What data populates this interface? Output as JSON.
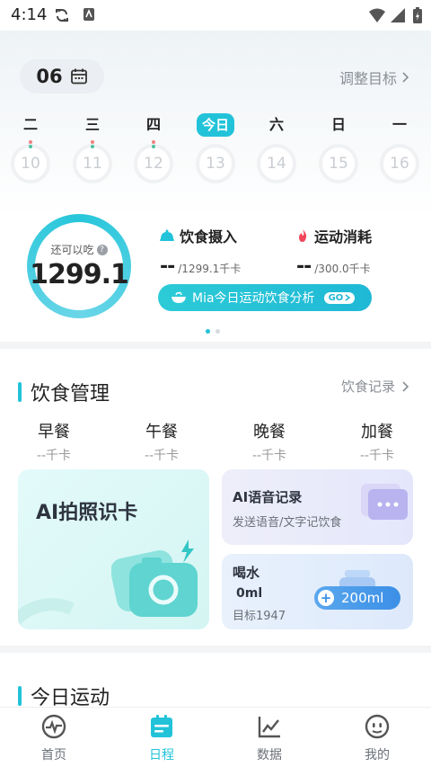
{
  "status_bar": {
    "time": "4:14"
  },
  "header": {
    "date_day": "06",
    "adjust_goal": "调整目标"
  },
  "week": [
    {
      "label": "二",
      "day": "10",
      "dots": [
        "#f08080",
        "#4cc3a0"
      ],
      "today": false
    },
    {
      "label": "三",
      "day": "11",
      "dots": [
        "#f08080",
        "#4cc3a0"
      ],
      "today": false
    },
    {
      "label": "四",
      "day": "12",
      "dots": [
        "#f08080",
        "#4cc3a0"
      ],
      "today": false
    },
    {
      "label": "今日",
      "day": "13",
      "dots": [],
      "today": true
    },
    {
      "label": "六",
      "day": "14",
      "dots": [],
      "today": false
    },
    {
      "label": "日",
      "day": "15",
      "dots": [],
      "today": false
    },
    {
      "label": "一",
      "day": "16",
      "dots": [],
      "today": false
    }
  ],
  "summary": {
    "can_eat_label": "还可以吃",
    "can_eat_value": "1299.1",
    "intake_title": "饮食摄入",
    "intake_value": "--",
    "intake_target": "/1299.1千卡",
    "burn_title": "运动消耗",
    "burn_value": "--",
    "burn_target": "/300.0千卡",
    "mia_label": "Mia今日运动饮食分析",
    "go_label": "GO"
  },
  "diet": {
    "title": "饮食管理",
    "record_link": "饮食记录",
    "meals": [
      {
        "name": "早餐",
        "kcal": "--千卡"
      },
      {
        "name": "午餐",
        "kcal": "--千卡"
      },
      {
        "name": "晚餐",
        "kcal": "--千卡"
      },
      {
        "name": "加餐",
        "kcal": "--千卡"
      }
    ],
    "ai_card": "AI拍照识卡",
    "voice_title": "AI语音记录",
    "voice_sub": "发送语音/文字记饮食",
    "water_title": "喝水",
    "water_amount": "0ml",
    "water_goal": "目标1947",
    "water_button": "200ml"
  },
  "exercise": {
    "title": "今日运动"
  },
  "tabs": [
    {
      "label": "首页",
      "icon": "pulse-icon",
      "active": false
    },
    {
      "label": "日程",
      "icon": "calendar-icon",
      "active": true
    },
    {
      "label": "数据",
      "icon": "chart-icon",
      "active": false
    },
    {
      "label": "我的",
      "icon": "profile-face-icon",
      "active": false
    }
  ],
  "colors": {
    "accent": "#22c3d9",
    "water": "#3b8fe6",
    "flame": "#f0455a"
  }
}
